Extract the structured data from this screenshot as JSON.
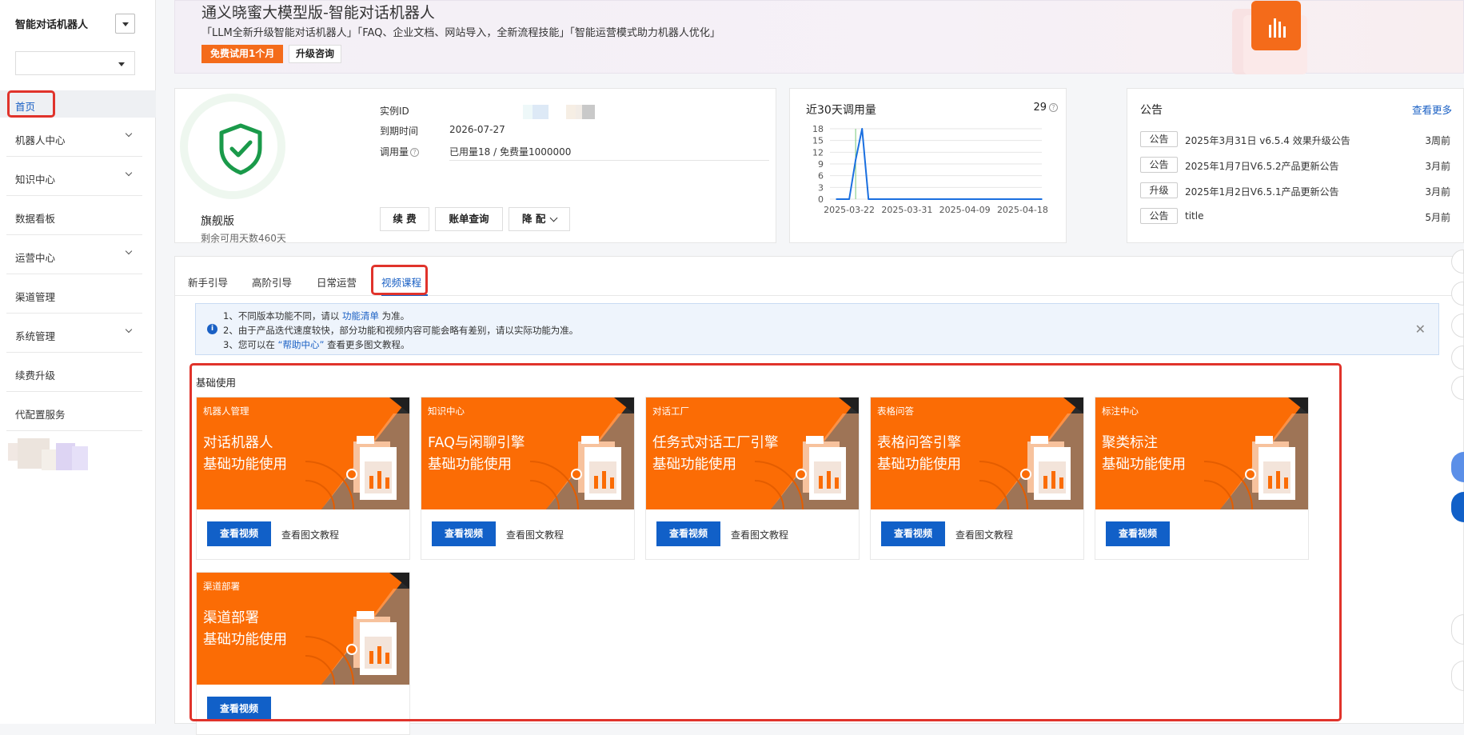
{
  "sidebar": {
    "title": "智能对话机器人",
    "items": [
      {
        "label": "首页",
        "expandable": false
      },
      {
        "label": "机器人中心",
        "expandable": true
      },
      {
        "label": "知识中心",
        "expandable": true
      },
      {
        "label": "数据看板",
        "expandable": false
      },
      {
        "label": "运营中心",
        "expandable": true
      },
      {
        "label": "渠道管理",
        "expandable": false
      },
      {
        "label": "系统管理",
        "expandable": true
      },
      {
        "label": "续费升级",
        "expandable": false
      },
      {
        "label": "代配置服务",
        "expandable": false
      }
    ]
  },
  "banner": {
    "title": "通义晓蜜大模型版-智能对话机器人",
    "subtitle": "「LLM全新升级智能对话机器人」「FAQ、企业文档、网站导入，全新流程技能」「智能运营模式助力机器人优化」",
    "trial_button": "免费试用1个月",
    "consult_button": "升级咨询"
  },
  "instance": {
    "plan": "旗舰版",
    "days_left": "剩余可用天数460天",
    "id_label": "实例ID",
    "expire_label": "到期时间",
    "expire_value": "2026-07-27",
    "usage_label": "调用量",
    "usage_value": "已用量18 / 免费量1000000",
    "renew_button": "续 费",
    "bill_button": "账单查询",
    "downgrade_button": "降 配"
  },
  "usage": {
    "title": "近30天调用量",
    "total": "29"
  },
  "chart_data": {
    "type": "line",
    "title": "近30天调用量",
    "x_ticks": [
      "2025-03-22",
      "2025-03-31",
      "2025-04-09",
      "2025-04-18"
    ],
    "y_ticks": [
      0,
      3,
      6,
      9,
      12,
      15,
      18
    ],
    "ylim": [
      0,
      18
    ],
    "series": [
      {
        "x": [
          "2025-03-20",
          "2025-03-21",
          "2025-03-22",
          "2025-03-23",
          "2025-03-24",
          "2025-03-25",
          "2025-03-26",
          "2025-04-21"
        ],
        "values": [
          0,
          0,
          0,
          10,
          18,
          0,
          0,
          0
        ]
      }
    ],
    "line_color": "#1a6fe0",
    "grid": true
  },
  "notices": {
    "title": "公告",
    "more": "查看更多",
    "items": [
      {
        "tag": "公告",
        "text": "2025年3月31日 v6.5.4 效果升级公告",
        "time": "3周前"
      },
      {
        "tag": "公告",
        "text": "2025年1月7日V6.5.2产品更新公告",
        "time": "3月前"
      },
      {
        "tag": "升级",
        "text": "2025年1月2日V6.5.1产品更新公告",
        "time": "3月前"
      },
      {
        "tag": "公告",
        "text": "title",
        "time": "5月前"
      }
    ]
  },
  "tabs": [
    {
      "label": "新手引导",
      "active": false
    },
    {
      "label": "高阶引导",
      "active": false
    },
    {
      "label": "日常运营",
      "active": false
    },
    {
      "label": "视频课程",
      "active": true
    }
  ],
  "info_box": {
    "line1_prefix": "1、不同版本功能不同，请以",
    "line1_link": "功能清单",
    "line1_suffix": "为准。",
    "line2": "2、由于产品迭代速度较快，部分功能和视频内容可能会略有差别，请以实际功能为准。",
    "line3_prefix": "3、您可以在",
    "line3_link": "“帮助中心”",
    "line3_suffix": "查看更多图文教程。"
  },
  "section": {
    "title": "基础使用",
    "cards": [
      {
        "category": "机器人管理",
        "title1": "对话机器人",
        "title2": "基础功能使用",
        "video_button": "查看视频",
        "doc_link": "查看图文教程"
      },
      {
        "category": "知识中心",
        "title1": "FAQ与闲聊引擎",
        "title2": "基础功能使用",
        "video_button": "查看视频",
        "doc_link": "查看图文教程"
      },
      {
        "category": "对话工厂",
        "title1": "任务式对话工厂引擎",
        "title2": "基础功能使用",
        "video_button": "查看视频",
        "doc_link": "查看图文教程"
      },
      {
        "category": "表格问答",
        "title1": "表格问答引擎",
        "title2": "基础功能使用",
        "video_button": "查看视频",
        "doc_link": "查看图文教程"
      },
      {
        "category": "标注中心",
        "title1": "聚类标注",
        "title2": "基础功能使用",
        "video_button": "查看视频",
        "doc_link": ""
      },
      {
        "category": "渠道部署",
        "title1": "渠道部署",
        "title2": "基础功能使用",
        "video_button": "查看视频",
        "doc_link": ""
      }
    ]
  },
  "colors": {
    "accent": "#1a60c4",
    "orange": "#fb6c05",
    "button_blue": "#1160c8",
    "highlight_red": "#e0332b"
  }
}
